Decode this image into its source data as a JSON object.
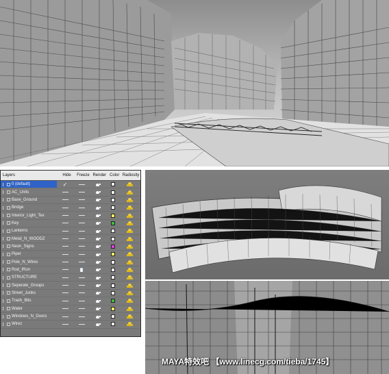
{
  "layers_panel": {
    "columns": {
      "name": "Layers",
      "hide": "Hide",
      "freeze": "Freeze",
      "render": "Render",
      "color": "Color",
      "radiosity": "Radiosity"
    },
    "layers": [
      {
        "name": "0 (default)",
        "selected": true,
        "hide": "check",
        "freeze": "dash",
        "render": "teapot",
        "color": "#ffffff",
        "radiosity": "on"
      },
      {
        "name": "AC_Units",
        "selected": false,
        "hide": "dash",
        "freeze": "dash",
        "render": "teapot",
        "color": "#ffffff",
        "radiosity": "on"
      },
      {
        "name": "Base_Ground",
        "selected": false,
        "hide": "dash",
        "freeze": "dash",
        "render": "teapot",
        "color": "#ffffff",
        "radiosity": "on"
      },
      {
        "name": "Bridge",
        "selected": false,
        "hide": "dash",
        "freeze": "dash",
        "render": "teapot",
        "color": "#ffffff",
        "radiosity": "on"
      },
      {
        "name": "Interior_Light_Tex",
        "selected": false,
        "hide": "dash",
        "freeze": "dash",
        "render": "teapot",
        "color": "#ffff66",
        "radiosity": "on"
      },
      {
        "name": "Key",
        "selected": false,
        "hide": "dash",
        "freeze": "dash",
        "render": "teapot",
        "color": "#3fbf3f",
        "radiosity": "on"
      },
      {
        "name": "Lanterns",
        "selected": false,
        "hide": "dash",
        "freeze": "dash",
        "render": "teapot",
        "color": "#ffffff",
        "radiosity": "on"
      },
      {
        "name": "Metal_N_WOODZ",
        "selected": false,
        "hide": "dash",
        "freeze": "dash",
        "render": "teapot",
        "color": "#ffffff",
        "radiosity": "on"
      },
      {
        "name": "Neon_Signs",
        "selected": false,
        "hide": "dash",
        "freeze": "dash",
        "render": "teapot",
        "color": "#e040e0",
        "radiosity": "on"
      },
      {
        "name": "Piper",
        "selected": false,
        "hide": "dash",
        "freeze": "dash",
        "render": "teapot",
        "color": "#ffff66",
        "radiosity": "on"
      },
      {
        "name": "Pole_N_Wires",
        "selected": false,
        "hide": "dash",
        "freeze": "dash",
        "render": "teapot",
        "color": "#ffffff",
        "radiosity": "on"
      },
      {
        "name": "Rod_IRon",
        "selected": false,
        "hide": "dash",
        "freeze": "bulb",
        "render": "teapot",
        "color": "#ffffff",
        "radiosity": "on"
      },
      {
        "name": "STRUCTURE",
        "selected": false,
        "hide": "dash",
        "freeze": "dash",
        "render": "teapot",
        "color": "#ffffff",
        "radiosity": "on"
      },
      {
        "name": "Seperate_Groups",
        "selected": false,
        "hide": "dash",
        "freeze": "dash",
        "render": "teapot",
        "color": "#ffffff",
        "radiosity": "on"
      },
      {
        "name": "Street_Junks",
        "selected": false,
        "hide": "dash",
        "freeze": "dash",
        "render": "teapot",
        "color": "#ffffff",
        "radiosity": "on"
      },
      {
        "name": "Trash_Bits",
        "selected": false,
        "hide": "dash",
        "freeze": "dash",
        "render": "teapot",
        "color": "#3fbf3f",
        "radiosity": "on"
      },
      {
        "name": "Water",
        "selected": false,
        "hide": "dash",
        "freeze": "dash",
        "render": "teapot",
        "color": "#ffff66",
        "radiosity": "on"
      },
      {
        "name": "Windows_N_Doors",
        "selected": false,
        "hide": "dash",
        "freeze": "dash",
        "render": "teapot",
        "color": "#ffffff",
        "radiosity": "on"
      },
      {
        "name": "Wirez",
        "selected": false,
        "hide": "dash",
        "freeze": "dash",
        "render": "teapot",
        "color": "#ffffff",
        "radiosity": "on"
      }
    ]
  },
  "watermark": "MAYA特效吧 【www.linecg.com/tieba/1745】"
}
